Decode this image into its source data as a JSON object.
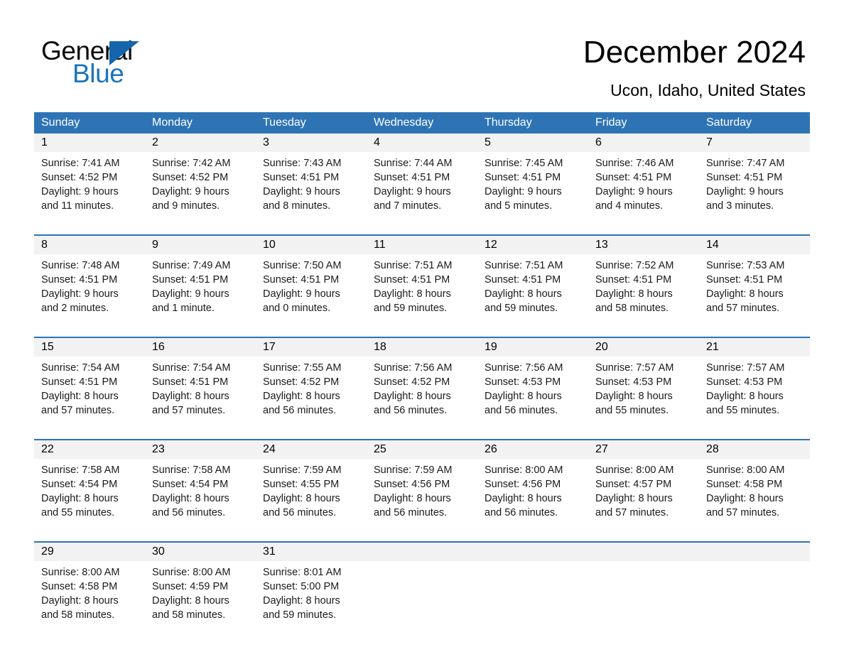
{
  "logo": {
    "word_one": "General",
    "word_two": "Blue",
    "triangle_color": "#1565ad",
    "blue_text_color": "#1a75bc"
  },
  "header": {
    "title": "December 2024",
    "subtitle": "Ucon, Idaho, United States"
  },
  "theme": {
    "header_blue": "#2e74b5",
    "daynum_band": "#f2f2f2",
    "separator_blue": "#2e74b5"
  },
  "calendar": {
    "day_headers": [
      "Sunday",
      "Monday",
      "Tuesday",
      "Wednesday",
      "Thursday",
      "Friday",
      "Saturday"
    ],
    "weeks": [
      [
        {
          "day": "1",
          "sunrise": "Sunrise: 7:41 AM",
          "sunset": "Sunset: 4:52 PM",
          "daylight_line1": "Daylight: 9 hours",
          "daylight_line2": "and 11 minutes."
        },
        {
          "day": "2",
          "sunrise": "Sunrise: 7:42 AM",
          "sunset": "Sunset: 4:52 PM",
          "daylight_line1": "Daylight: 9 hours",
          "daylight_line2": "and 9 minutes."
        },
        {
          "day": "3",
          "sunrise": "Sunrise: 7:43 AM",
          "sunset": "Sunset: 4:51 PM",
          "daylight_line1": "Daylight: 9 hours",
          "daylight_line2": "and 8 minutes."
        },
        {
          "day": "4",
          "sunrise": "Sunrise: 7:44 AM",
          "sunset": "Sunset: 4:51 PM",
          "daylight_line1": "Daylight: 9 hours",
          "daylight_line2": "and 7 minutes."
        },
        {
          "day": "5",
          "sunrise": "Sunrise: 7:45 AM",
          "sunset": "Sunset: 4:51 PM",
          "daylight_line1": "Daylight: 9 hours",
          "daylight_line2": "and 5 minutes."
        },
        {
          "day": "6",
          "sunrise": "Sunrise: 7:46 AM",
          "sunset": "Sunset: 4:51 PM",
          "daylight_line1": "Daylight: 9 hours",
          "daylight_line2": "and 4 minutes."
        },
        {
          "day": "7",
          "sunrise": "Sunrise: 7:47 AM",
          "sunset": "Sunset: 4:51 PM",
          "daylight_line1": "Daylight: 9 hours",
          "daylight_line2": "and 3 minutes."
        }
      ],
      [
        {
          "day": "8",
          "sunrise": "Sunrise: 7:48 AM",
          "sunset": "Sunset: 4:51 PM",
          "daylight_line1": "Daylight: 9 hours",
          "daylight_line2": "and 2 minutes."
        },
        {
          "day": "9",
          "sunrise": "Sunrise: 7:49 AM",
          "sunset": "Sunset: 4:51 PM",
          "daylight_line1": "Daylight: 9 hours",
          "daylight_line2": "and 1 minute."
        },
        {
          "day": "10",
          "sunrise": "Sunrise: 7:50 AM",
          "sunset": "Sunset: 4:51 PM",
          "daylight_line1": "Daylight: 9 hours",
          "daylight_line2": "and 0 minutes."
        },
        {
          "day": "11",
          "sunrise": "Sunrise: 7:51 AM",
          "sunset": "Sunset: 4:51 PM",
          "daylight_line1": "Daylight: 8 hours",
          "daylight_line2": "and 59 minutes."
        },
        {
          "day": "12",
          "sunrise": "Sunrise: 7:51 AM",
          "sunset": "Sunset: 4:51 PM",
          "daylight_line1": "Daylight: 8 hours",
          "daylight_line2": "and 59 minutes."
        },
        {
          "day": "13",
          "sunrise": "Sunrise: 7:52 AM",
          "sunset": "Sunset: 4:51 PM",
          "daylight_line1": "Daylight: 8 hours",
          "daylight_line2": "and 58 minutes."
        },
        {
          "day": "14",
          "sunrise": "Sunrise: 7:53 AM",
          "sunset": "Sunset: 4:51 PM",
          "daylight_line1": "Daylight: 8 hours",
          "daylight_line2": "and 57 minutes."
        }
      ],
      [
        {
          "day": "15",
          "sunrise": "Sunrise: 7:54 AM",
          "sunset": "Sunset: 4:51 PM",
          "daylight_line1": "Daylight: 8 hours",
          "daylight_line2": "and 57 minutes."
        },
        {
          "day": "16",
          "sunrise": "Sunrise: 7:54 AM",
          "sunset": "Sunset: 4:51 PM",
          "daylight_line1": "Daylight: 8 hours",
          "daylight_line2": "and 57 minutes."
        },
        {
          "day": "17",
          "sunrise": "Sunrise: 7:55 AM",
          "sunset": "Sunset: 4:52 PM",
          "daylight_line1": "Daylight: 8 hours",
          "daylight_line2": "and 56 minutes."
        },
        {
          "day": "18",
          "sunrise": "Sunrise: 7:56 AM",
          "sunset": "Sunset: 4:52 PM",
          "daylight_line1": "Daylight: 8 hours",
          "daylight_line2": "and 56 minutes."
        },
        {
          "day": "19",
          "sunrise": "Sunrise: 7:56 AM",
          "sunset": "Sunset: 4:53 PM",
          "daylight_line1": "Daylight: 8 hours",
          "daylight_line2": "and 56 minutes."
        },
        {
          "day": "20",
          "sunrise": "Sunrise: 7:57 AM",
          "sunset": "Sunset: 4:53 PM",
          "daylight_line1": "Daylight: 8 hours",
          "daylight_line2": "and 55 minutes."
        },
        {
          "day": "21",
          "sunrise": "Sunrise: 7:57 AM",
          "sunset": "Sunset: 4:53 PM",
          "daylight_line1": "Daylight: 8 hours",
          "daylight_line2": "and 55 minutes."
        }
      ],
      [
        {
          "day": "22",
          "sunrise": "Sunrise: 7:58 AM",
          "sunset": "Sunset: 4:54 PM",
          "daylight_line1": "Daylight: 8 hours",
          "daylight_line2": "and 55 minutes."
        },
        {
          "day": "23",
          "sunrise": "Sunrise: 7:58 AM",
          "sunset": "Sunset: 4:54 PM",
          "daylight_line1": "Daylight: 8 hours",
          "daylight_line2": "and 56 minutes."
        },
        {
          "day": "24",
          "sunrise": "Sunrise: 7:59 AM",
          "sunset": "Sunset: 4:55 PM",
          "daylight_line1": "Daylight: 8 hours",
          "daylight_line2": "and 56 minutes."
        },
        {
          "day": "25",
          "sunrise": "Sunrise: 7:59 AM",
          "sunset": "Sunset: 4:56 PM",
          "daylight_line1": "Daylight: 8 hours",
          "daylight_line2": "and 56 minutes."
        },
        {
          "day": "26",
          "sunrise": "Sunrise: 8:00 AM",
          "sunset": "Sunset: 4:56 PM",
          "daylight_line1": "Daylight: 8 hours",
          "daylight_line2": "and 56 minutes."
        },
        {
          "day": "27",
          "sunrise": "Sunrise: 8:00 AM",
          "sunset": "Sunset: 4:57 PM",
          "daylight_line1": "Daylight: 8 hours",
          "daylight_line2": "and 57 minutes."
        },
        {
          "day": "28",
          "sunrise": "Sunrise: 8:00 AM",
          "sunset": "Sunset: 4:58 PM",
          "daylight_line1": "Daylight: 8 hours",
          "daylight_line2": "and 57 minutes."
        }
      ],
      [
        {
          "day": "29",
          "sunrise": "Sunrise: 8:00 AM",
          "sunset": "Sunset: 4:58 PM",
          "daylight_line1": "Daylight: 8 hours",
          "daylight_line2": "and 58 minutes."
        },
        {
          "day": "30",
          "sunrise": "Sunrise: 8:00 AM",
          "sunset": "Sunset: 4:59 PM",
          "daylight_line1": "Daylight: 8 hours",
          "daylight_line2": "and 58 minutes."
        },
        {
          "day": "31",
          "sunrise": "Sunrise: 8:01 AM",
          "sunset": "Sunset: 5:00 PM",
          "daylight_line1": "Daylight: 8 hours",
          "daylight_line2": "and 59 minutes."
        },
        {
          "day": "",
          "sunrise": "",
          "sunset": "",
          "daylight_line1": "",
          "daylight_line2": ""
        },
        {
          "day": "",
          "sunrise": "",
          "sunset": "",
          "daylight_line1": "",
          "daylight_line2": ""
        },
        {
          "day": "",
          "sunrise": "",
          "sunset": "",
          "daylight_line1": "",
          "daylight_line2": ""
        },
        {
          "day": "",
          "sunrise": "",
          "sunset": "",
          "daylight_line1": "",
          "daylight_line2": ""
        }
      ]
    ]
  }
}
